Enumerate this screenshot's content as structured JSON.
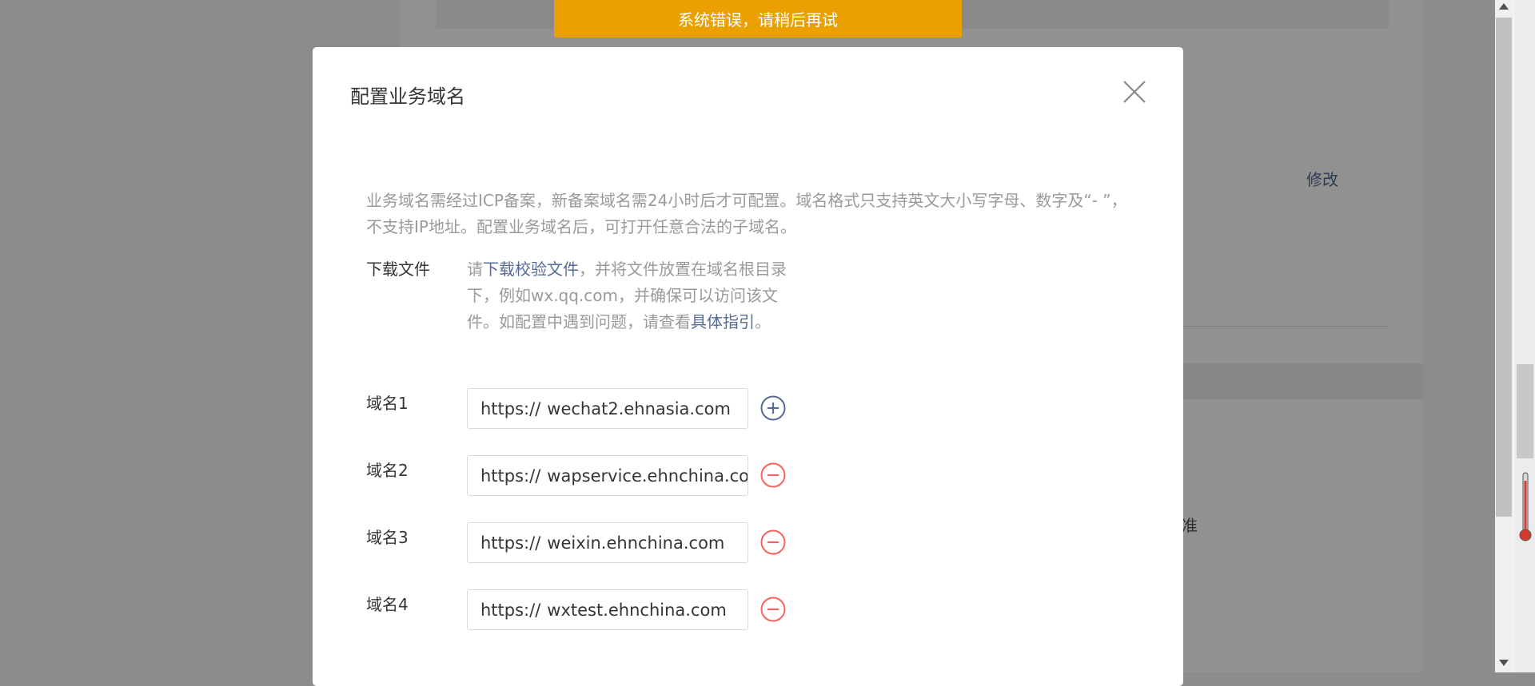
{
  "background": {
    "modify_link": "修改",
    "partial_text": "准"
  },
  "toast": {
    "message": "系统错误，请稍后再试"
  },
  "dialog": {
    "title": "配置业务域名",
    "notice": "业务域名需经过ICP备案，新备案域名需24小时后才可配置。域名格式只支持英文大小写字母、数字及“- ”，不支持IP地址。配置业务域名后，可打开任意合法的子域名。",
    "download": {
      "label": "下载文件",
      "text_before": "请",
      "link_text": "下载校验文件",
      "text_middle": "，并将文件放置在域名根目录下，例如wx.qq.com，并确保可以访问该文件。如配置中遇到问题，请查看",
      "guide_link": "具体指引",
      "text_after": "。"
    },
    "domains": [
      {
        "label": "域名1",
        "prefix": "https://",
        "value": "wechat2.ehnasia.com",
        "action_icon": "plus-circle-icon"
      },
      {
        "label": "域名2",
        "prefix": "https://",
        "value": "wapservice.ehnchina.com",
        "action_icon": "minus-circle-icon"
      },
      {
        "label": "域名3",
        "prefix": "https://",
        "value": "weixin.ehnchina.com",
        "action_icon": "minus-circle-icon"
      },
      {
        "label": "域名4",
        "prefix": "https://",
        "value": "wxtest.ehnchina.com",
        "action_icon": "minus-circle-icon"
      }
    ]
  },
  "colors": {
    "toast_bg": "#eaa000",
    "link": "#576b95",
    "remove_icon": "#f76260",
    "add_icon": "#576b95",
    "overlay": "#8c8c8c"
  }
}
